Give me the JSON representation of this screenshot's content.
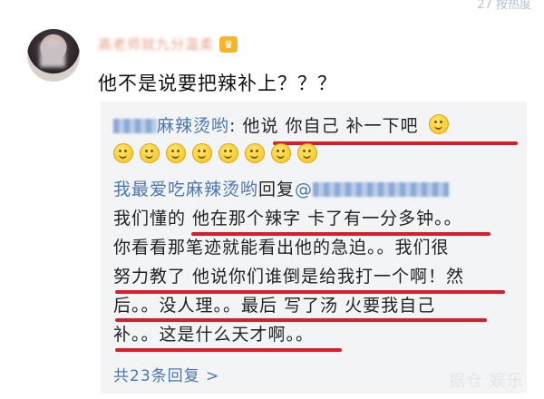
{
  "top_hint": "27 按热度",
  "post": {
    "username": "高老师就九分温柔",
    "comment": "他不是说要把辣补上？？？"
  },
  "replies": {
    "first": {
      "author_visible": "麻辣烫哟",
      "text": ": 他说 你自己 补一下吧"
    },
    "second": {
      "author": "我最爱吃麻辣烫哟",
      "reply_word": "回复",
      "mention_prefix": "@",
      "lines": [
        "我们懂的 他在那个辣字 卡了有一分多钟。。",
        "你看看那笔迹就能看出他的急迫。。我们很",
        "努力教了 他说你们谁倒是给我打一个啊！然",
        "后。。没人理。。最后 写了汤 火要我自己",
        "补。。这是什么天才啊。。"
      ]
    },
    "reply_count": "共23条回复 >"
  },
  "watermark": "据仓 娱乐",
  "colors": {
    "link": "#4d76b0",
    "underline": "#d81e2a",
    "reply_bg": "#f3f4f6"
  }
}
